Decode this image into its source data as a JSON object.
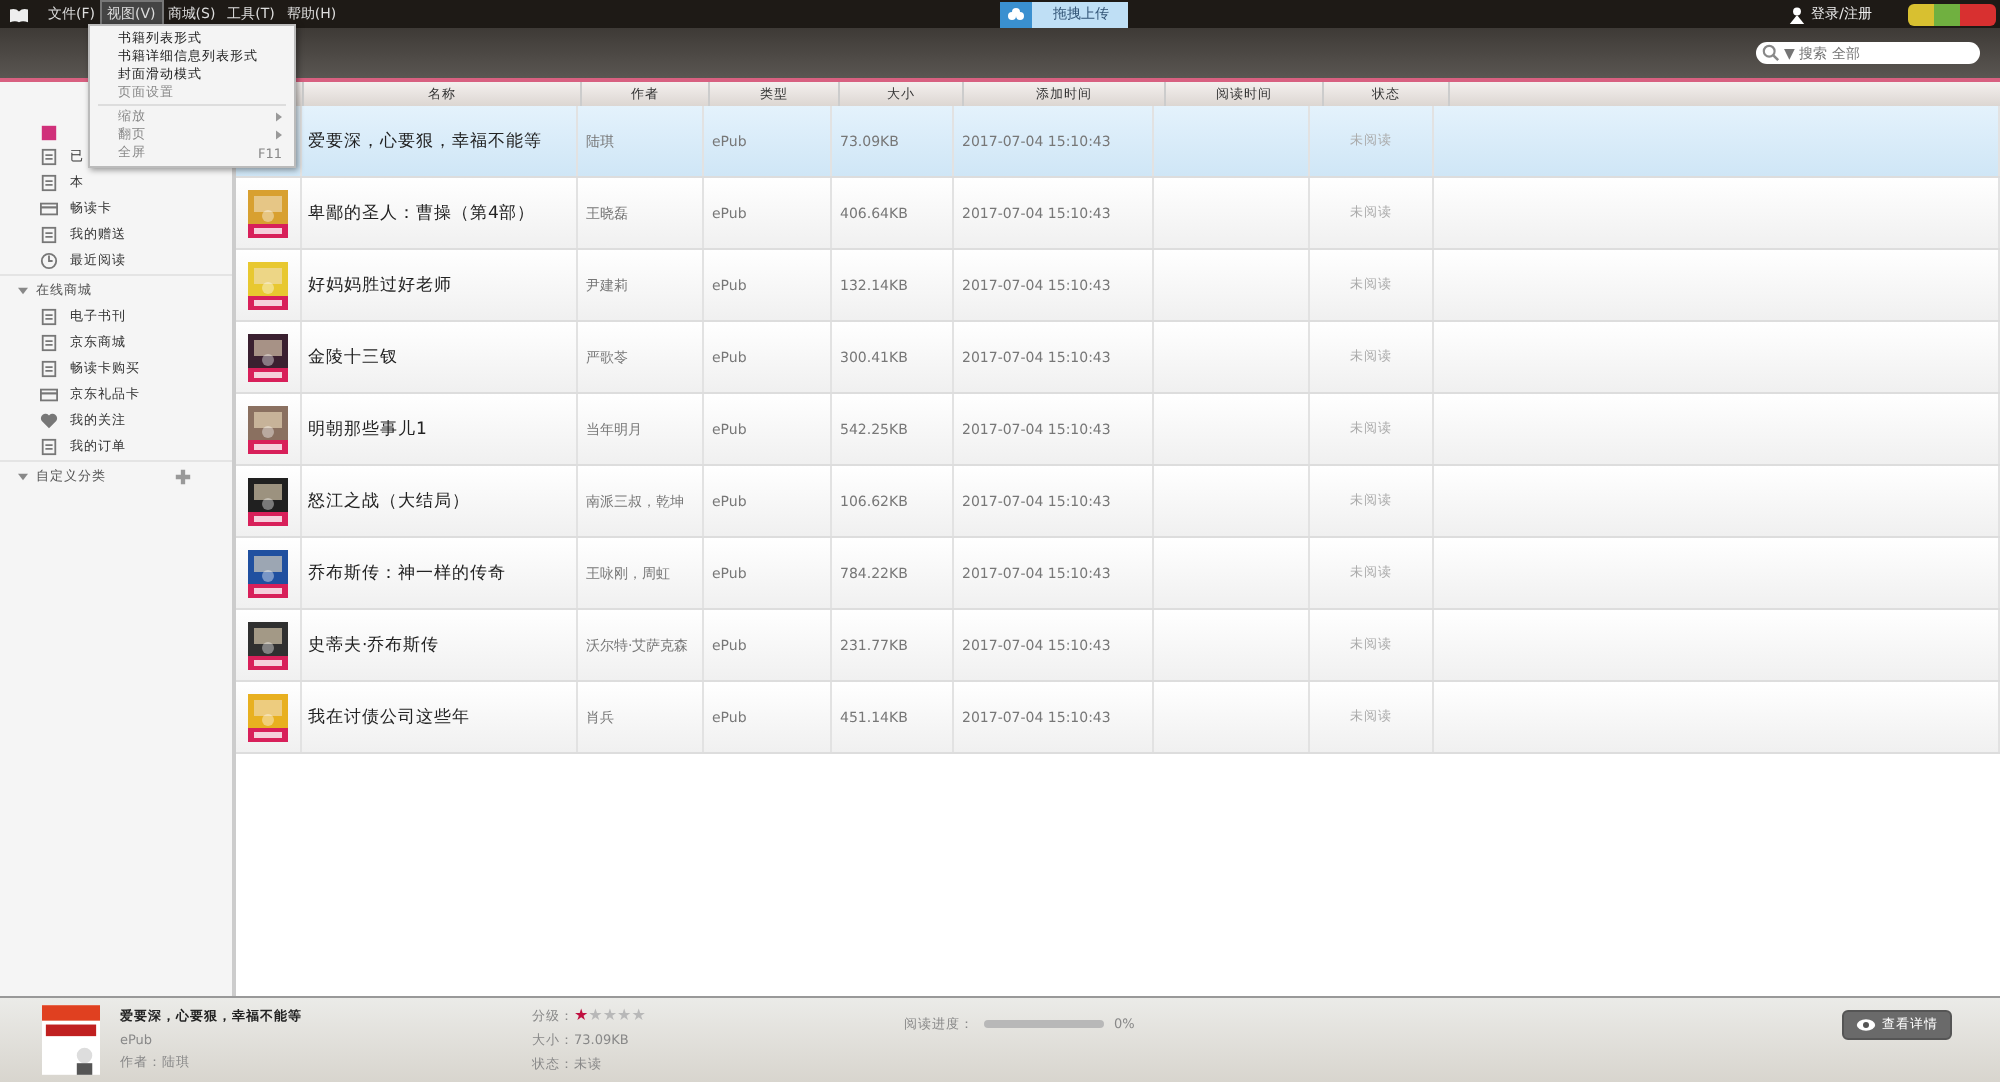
{
  "menubar": [
    {
      "label": "文件(F)",
      "selected": false
    },
    {
      "label": "视图(V)",
      "selected": true
    },
    {
      "label": "商城(S)",
      "selected": false
    },
    {
      "label": "工具(T)",
      "selected": false
    },
    {
      "label": "帮助(H)",
      "selected": false
    }
  ],
  "view_menu": [
    {
      "label": "书籍列表形式",
      "kind": "item"
    },
    {
      "label": "书籍详细信息列表形式",
      "kind": "item"
    },
    {
      "label": "封面滑动模式",
      "kind": "item"
    },
    {
      "label": "页面设置",
      "kind": "item"
    },
    {
      "label": "缩放",
      "kind": "submenu"
    },
    {
      "label": "翻页",
      "kind": "submenu"
    },
    {
      "label": "全屏",
      "shortcut": "F11",
      "kind": "item"
    }
  ],
  "upload_button": "拖拽上传",
  "login": "登录/注册",
  "search": {
    "placeholder": "▼ 搜索 全部"
  },
  "sidebar": {
    "items": [
      {
        "label": "已"
      },
      {
        "label": "本"
      },
      {
        "label": "畅读卡"
      },
      {
        "label": "我的赠送"
      },
      {
        "label": "最近阅读"
      }
    ],
    "sections": [
      {
        "title": "在线商城",
        "expanded": true,
        "items": [
          {
            "label": "电子书刊"
          },
          {
            "label": "京东商城"
          },
          {
            "label": "畅读卡购买"
          },
          {
            "label": "京东礼品卡"
          },
          {
            "label": "我的关注"
          },
          {
            "label": "我的订单"
          }
        ]
      },
      {
        "title": "自定义分类",
        "expanded": true
      }
    ]
  },
  "table": {
    "columns": [
      "名称",
      "作者",
      "类型",
      "大小",
      "添加时间",
      "阅读时间",
      "状态"
    ],
    "rows": [
      {
        "title": "爱要深，心要狠，幸福不能等",
        "author": "陆琪",
        "type": "ePub",
        "size": "73.09KB",
        "added": "2017-07-04 15:10:43",
        "status": "未阅读",
        "selected": true
      },
      {
        "title": "卑鄙的圣人：曹操（第4部）",
        "author": "王晓磊",
        "type": "ePub",
        "size": "406.64KB",
        "added": "2017-07-04 15:10:43",
        "status": "未阅读",
        "selected": false
      },
      {
        "title": "好妈妈胜过好老师",
        "author": "尹建莉",
        "type": "ePub",
        "size": "132.14KB",
        "added": "2017-07-04 15:10:43",
        "status": "未阅读",
        "selected": false
      },
      {
        "title": "金陵十三钗",
        "author": "严歌苓",
        "type": "ePub",
        "size": "300.41KB",
        "added": "2017-07-04 15:10:43",
        "status": "未阅读",
        "selected": false
      },
      {
        "title": "明朝那些事儿1",
        "author": "当年明月",
        "type": "ePub",
        "size": "542.25KB",
        "added": "2017-07-04 15:10:43",
        "status": "未阅读",
        "selected": false
      },
      {
        "title": "怒江之战（大结局）",
        "author": "南派三叔，乾坤",
        "type": "ePub",
        "size": "106.62KB",
        "added": "2017-07-04 15:10:43",
        "status": "未阅读",
        "selected": false
      },
      {
        "title": "乔布斯传：神一样的传奇",
        "author": "王咏刚，周虹",
        "type": "ePub",
        "size": "784.22KB",
        "added": "2017-07-04 15:10:43",
        "status": "未阅读",
        "selected": false
      },
      {
        "title": "史蒂夫·乔布斯传",
        "author": "沃尔特·艾萨克森",
        "type": "ePub",
        "size": "231.77KB",
        "added": "2017-07-04 15:10:43",
        "status": "未阅读",
        "selected": false
      },
      {
        "title": "我在讨债公司这些年",
        "author": "肖兵",
        "type": "ePub",
        "size": "451.14KB",
        "added": "2017-07-04 15:10:43",
        "status": "未阅读",
        "selected": false
      }
    ]
  },
  "details": {
    "title": "爱要深，心要狠，幸福不能等",
    "type": "ePub",
    "author": "作者：陆琪",
    "rating_label": "分级：",
    "stars": 1,
    "size": "大小：73.09KB",
    "status": "状态：未读",
    "progress_label": "阅读进度：",
    "level": 0,
    "progress_text": "0%",
    "details_button": "查看详情"
  }
}
